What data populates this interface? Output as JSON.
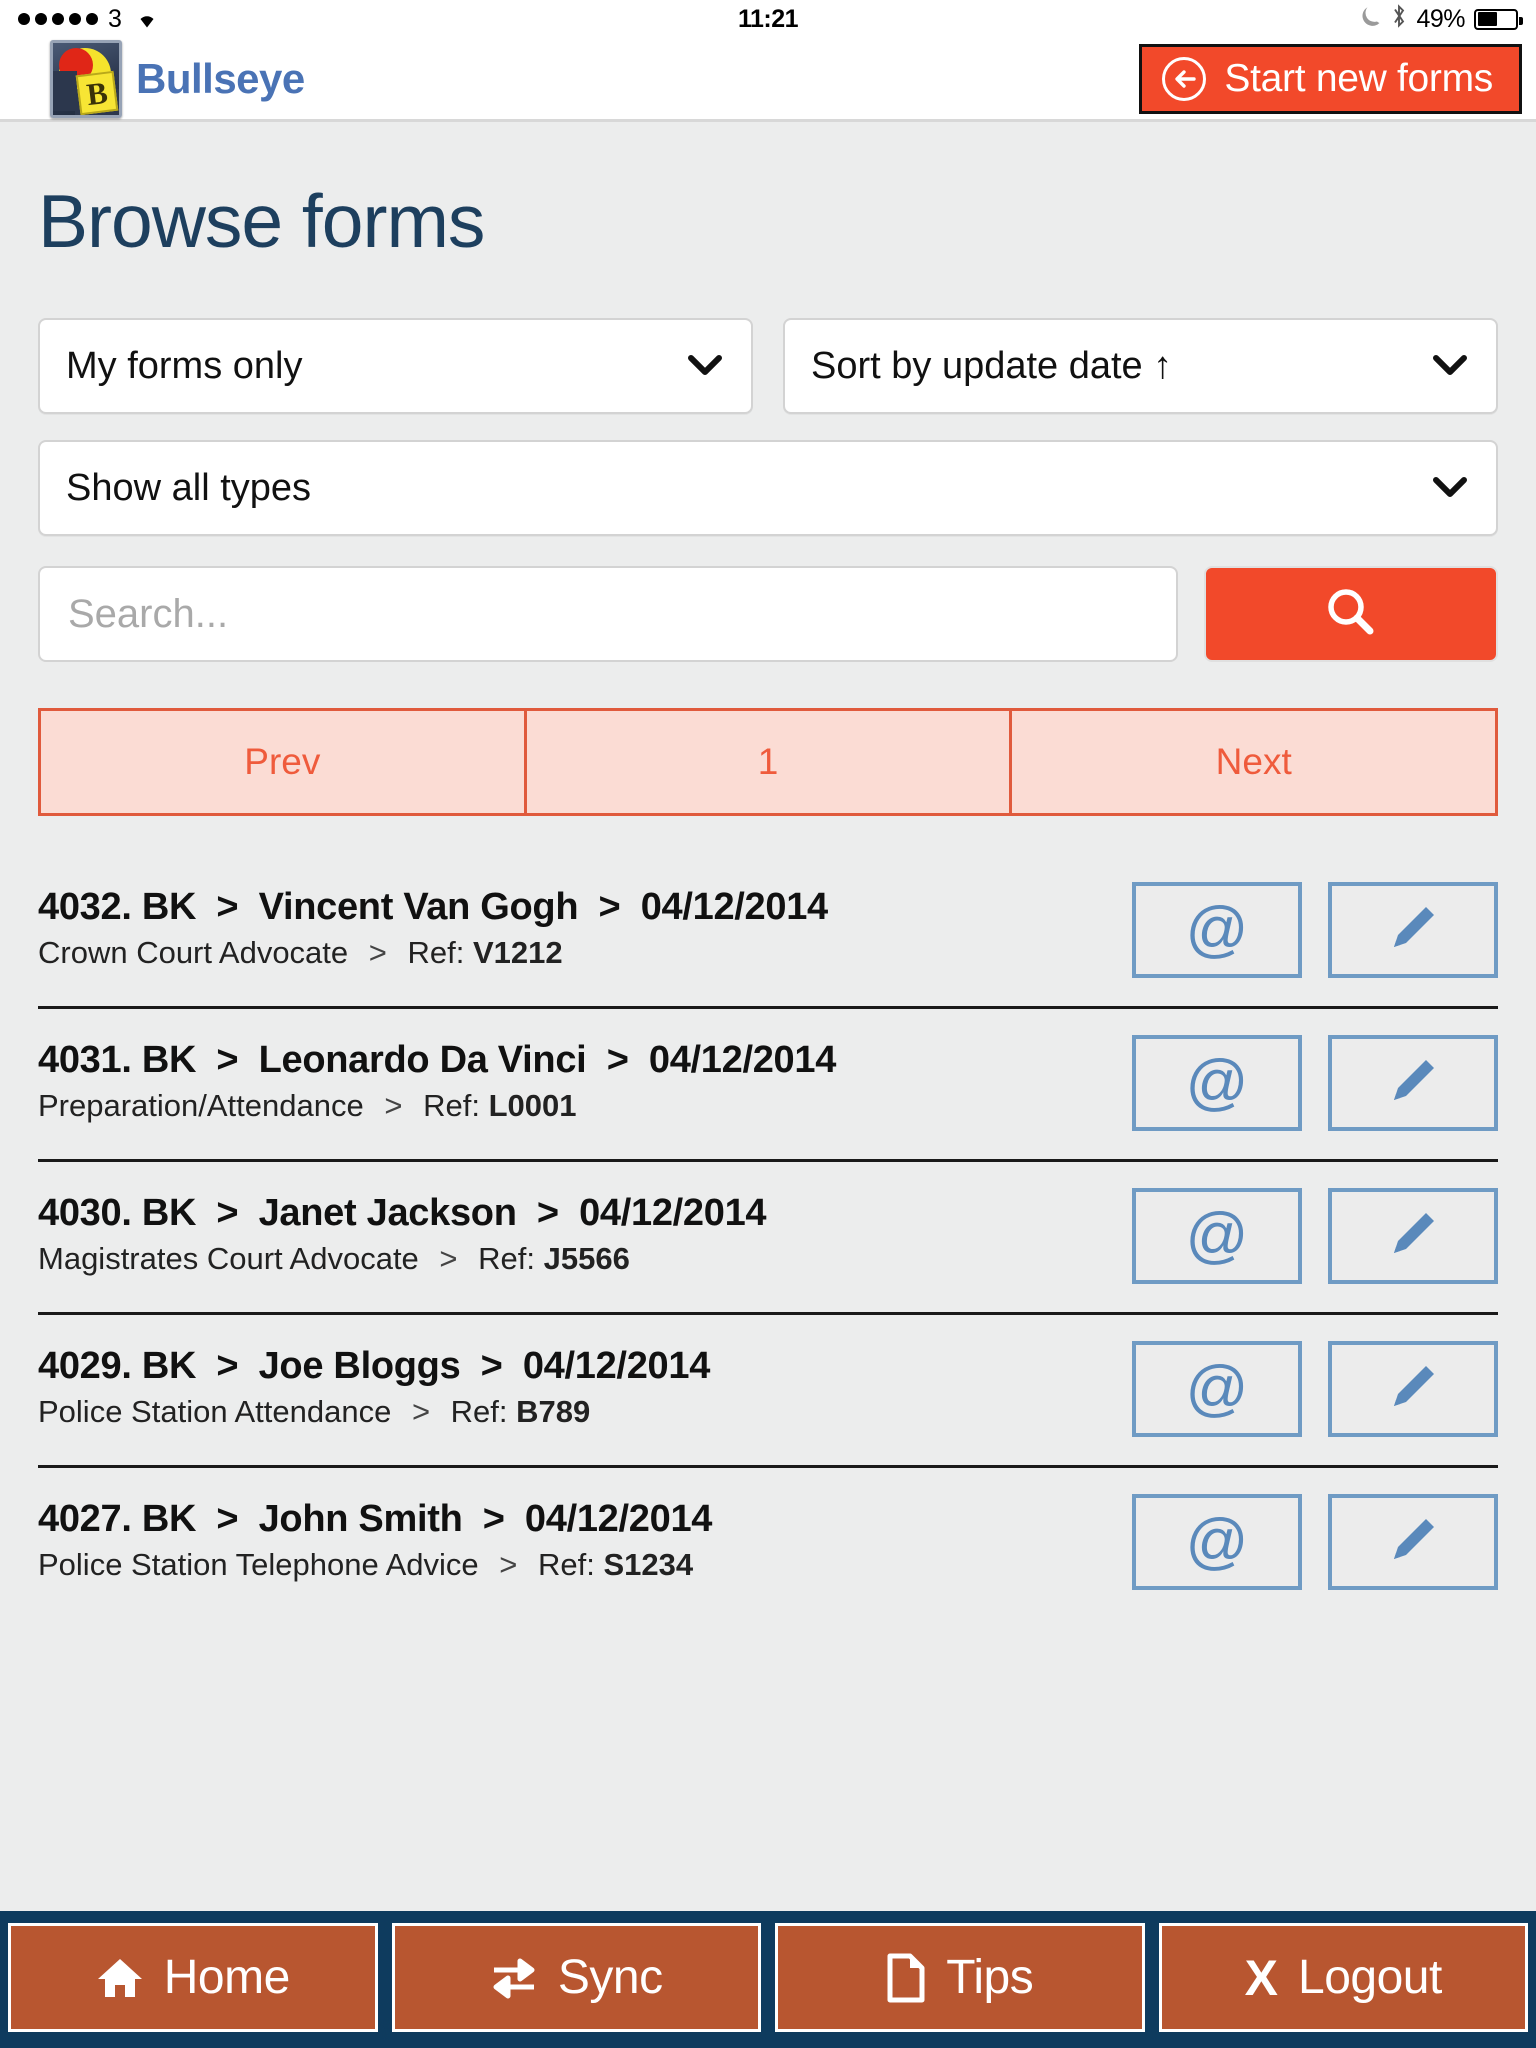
{
  "status_bar": {
    "signal_dots": 5,
    "carrier": "3",
    "wifi_icon": "wifi-icon",
    "time": "11:21",
    "moon_icon": "moon-icon",
    "bluetooth_icon": "bluetooth-icon",
    "battery_percent": "49%",
    "battery_level": 49
  },
  "appbar": {
    "logo_icon": "bullseye-logo-icon",
    "logo_letter": "B",
    "brand_name": "Bullseye",
    "start_button": {
      "label": "Start new forms",
      "icon": "circle-arrow-left-icon",
      "bg_color": "#F2492A"
    }
  },
  "page": {
    "title": "Browse forms",
    "title_color": "#1D3F5E",
    "background": "#ECEDED"
  },
  "filters": {
    "owner": {
      "value": "My forms only",
      "icon": "chevron-down-icon"
    },
    "sort": {
      "value": "Sort by update date ↑",
      "icon": "chevron-down-icon"
    },
    "type": {
      "value": "Show all types",
      "icon": "chevron-down-icon"
    }
  },
  "search": {
    "placeholder": "Search...",
    "value": "",
    "button_icon": "search-icon"
  },
  "pagination": {
    "prev_label": "Prev",
    "page_label": "1",
    "next_label": "Next",
    "border_color": "#E05A3C",
    "fill_color": "#FBDCD4",
    "text_color": "#EF5B3C"
  },
  "forms": [
    {
      "id": "4032.",
      "initials": "BK",
      "name": "Vincent Van Gogh",
      "date": "04/12/2014",
      "type": "Crown Court Advocate",
      "ref_label": "Ref:",
      "ref": "V1212",
      "email_icon": "at-icon",
      "edit_icon": "pencil-icon"
    },
    {
      "id": "4031.",
      "initials": "BK",
      "name": "Leonardo Da Vinci",
      "date": "04/12/2014",
      "type": "Preparation/Attendance",
      "ref_label": "Ref:",
      "ref": "L0001",
      "email_icon": "at-icon",
      "edit_icon": "pencil-icon"
    },
    {
      "id": "4030.",
      "initials": "BK",
      "name": "Janet Jackson",
      "date": "04/12/2014",
      "type": "Magistrates Court Advocate",
      "ref_label": "Ref:",
      "ref": "J5566",
      "email_icon": "at-icon",
      "edit_icon": "pencil-icon"
    },
    {
      "id": "4029.",
      "initials": "BK",
      "name": "Joe Bloggs",
      "date": "04/12/2014",
      "type": "Police Station Attendance",
      "ref_label": "Ref:",
      "ref": "B789",
      "email_icon": "at-icon",
      "edit_icon": "pencil-icon"
    },
    {
      "id": "4027.",
      "initials": "BK",
      "name": "John Smith",
      "date": "04/12/2014",
      "type": "Police Station Telephone Advice",
      "ref_label": "Ref:",
      "ref": "S1234",
      "email_icon": "at-icon",
      "edit_icon": "pencil-icon"
    }
  ],
  "row_separator": ">",
  "bottom_nav": {
    "bg_color": "#0E3B5E",
    "button_color": "#B85630",
    "items": [
      {
        "label": "Home",
        "icon": "home-icon"
      },
      {
        "label": "Sync",
        "icon": "sync-arrows-icon"
      },
      {
        "label": "Tips",
        "icon": "document-icon"
      },
      {
        "label": "Logout",
        "icon": "x-icon"
      }
    ]
  }
}
